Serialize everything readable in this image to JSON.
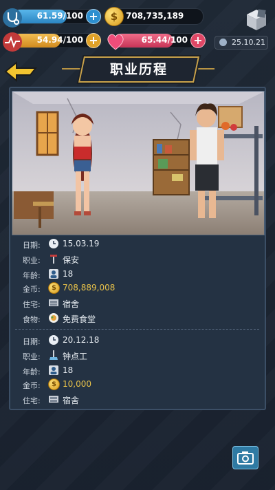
{
  "stats": {
    "health": {
      "text": "61.59/100",
      "fraction": 0.6159,
      "color": "#3d9ed8"
    },
    "energy": {
      "text": "54.94/100",
      "fraction": 0.5494,
      "color": "#e6a23a"
    },
    "happiness": {
      "text": "65.44/100",
      "fraction": 0.6544,
      "color": "#e0506f"
    },
    "coins": "708,735,189",
    "game_date": "25.10.21"
  },
  "page_title": "职业历程",
  "labels": {
    "date": "日期:",
    "job": "职业:",
    "age": "年龄:",
    "coins": "金币:",
    "housing": "住宅:",
    "food": "食物:"
  },
  "entries": [
    {
      "date": "15.03.19",
      "job": "保安",
      "age": "18",
      "coins": "708,889,008",
      "housing": "宿舍",
      "food": "免费食堂"
    },
    {
      "date": "20.12.18",
      "job": "钟点工",
      "age": "18",
      "coins": "10,000",
      "housing": "宿舍"
    }
  ]
}
